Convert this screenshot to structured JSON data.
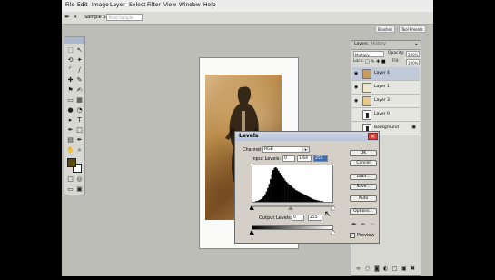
{
  "menubar": {
    "items": [
      "File",
      "Edit",
      "Image",
      "Layer",
      "Select",
      "Filter",
      "View",
      "Window",
      "Help"
    ]
  },
  "options_bar": {
    "tool_icon": "eyedropper-icon",
    "sample_size_label": "Sample Size:",
    "sample_size_value": "Point Sample",
    "palette_tabs": [
      "Brushes",
      "Tool Presets"
    ]
  },
  "layers_panel": {
    "tabs": [
      "Layers",
      "History"
    ],
    "blend_mode": "Multiply",
    "opacity_label": "Opacity:",
    "opacity_value": "100%",
    "lock_label": "Lock:",
    "fill_label": "Fill:",
    "fill_value": "100%",
    "layers": [
      {
        "name": "Layer 4",
        "visible": true,
        "active": true
      },
      {
        "name": "Layer 1",
        "visible": true,
        "active": false
      },
      {
        "name": "Layer 3",
        "visible": true,
        "active": false
      },
      {
        "name": "Layer 0",
        "visible": false,
        "active": false
      },
      {
        "name": "Background",
        "visible": false,
        "active": false
      }
    ]
  },
  "levels_dialog": {
    "title": "Levels",
    "channel_label": "Channel:",
    "channel_value": "RGB",
    "input_levels_label": "Input Levels:",
    "input_black": "0",
    "input_gamma": "1.64",
    "input_white": "255",
    "output_levels_label": "Output Levels:",
    "output_black": "0",
    "output_white": "255",
    "buttons": {
      "ok": "OK",
      "cancel": "Cancel",
      "load": "Load...",
      "save": "Save...",
      "auto": "Auto",
      "options": "Options..."
    },
    "preview_label": "Preview",
    "preview_checked": true,
    "histogram": [
      0,
      0,
      1,
      1,
      2,
      3,
      4,
      6,
      8,
      11,
      15,
      20,
      26,
      33,
      40,
      46,
      49,
      50,
      48,
      45,
      42,
      39,
      36,
      34,
      31,
      29,
      27,
      25,
      24,
      22,
      20,
      19,
      17,
      16,
      15,
      14,
      13,
      12,
      11,
      10,
      9,
      8,
      7,
      6,
      5,
      4,
      3,
      3,
      2,
      2,
      1,
      1,
      1,
      0,
      0,
      0,
      0,
      0,
      0,
      0
    ],
    "slider_positions": {
      "black": 0,
      "gamma": 1.64,
      "white": 255
    }
  },
  "colors": {
    "foreground": "#5b4a0c",
    "background": "#ffffff",
    "accent": "#d9443a"
  }
}
